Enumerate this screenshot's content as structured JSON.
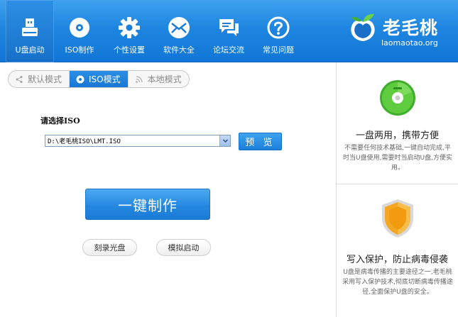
{
  "nav": {
    "items": [
      {
        "label": "U盘启动",
        "icon": "usb-drive-icon",
        "active": true
      },
      {
        "label": "ISO制作",
        "icon": "disc-icon",
        "active": false
      },
      {
        "label": "个性设置",
        "icon": "gear-icon",
        "active": false
      },
      {
        "label": "软件大全",
        "icon": "envelope-icon",
        "active": false
      },
      {
        "label": "论坛交流",
        "icon": "chat-bubbles-icon",
        "active": false
      },
      {
        "label": "常见问题",
        "icon": "question-mark-icon",
        "active": false
      }
    ]
  },
  "logo": {
    "text": "老毛桃",
    "url": "laomaotao.org",
    "icon": "peach-logo-icon"
  },
  "mode_tabs": [
    {
      "label": "默认模式",
      "icon": "share-icon",
      "active": false
    },
    {
      "label": "ISO模式",
      "icon": "disc-small-icon",
      "active": true
    },
    {
      "label": "本地模式",
      "icon": "signal-icon",
      "active": false
    }
  ],
  "main": {
    "select_label": "请选择ISO",
    "iso_path": "D:\\老毛桃ISO\\LMT.ISO",
    "browse_label": "预 览",
    "make_label": "一键制作",
    "burn_label": "刻录光盘",
    "simulate_label": "模拟启动"
  },
  "features": [
    {
      "title": "一盘两用，携带方便",
      "desc": "不需要任何技术基础,一键自动完成,平时当U盘使用,需要时当启动U盘,方便实用。",
      "icon": "green-disc-icon"
    },
    {
      "title": "写入保护，防止病毒侵袭",
      "desc": "U盘是病毒传播的主要途径之一,老毛桃采用写入保护技术,彻底切断病毒传播途径,全面保护U盘的安全。",
      "icon": "shield-icon"
    }
  ],
  "colors": {
    "header_blue": "#1e86e0",
    "button_blue": "#2588e0",
    "disc_green": "#4cbf3a",
    "shield_orange": "#f5a623"
  }
}
